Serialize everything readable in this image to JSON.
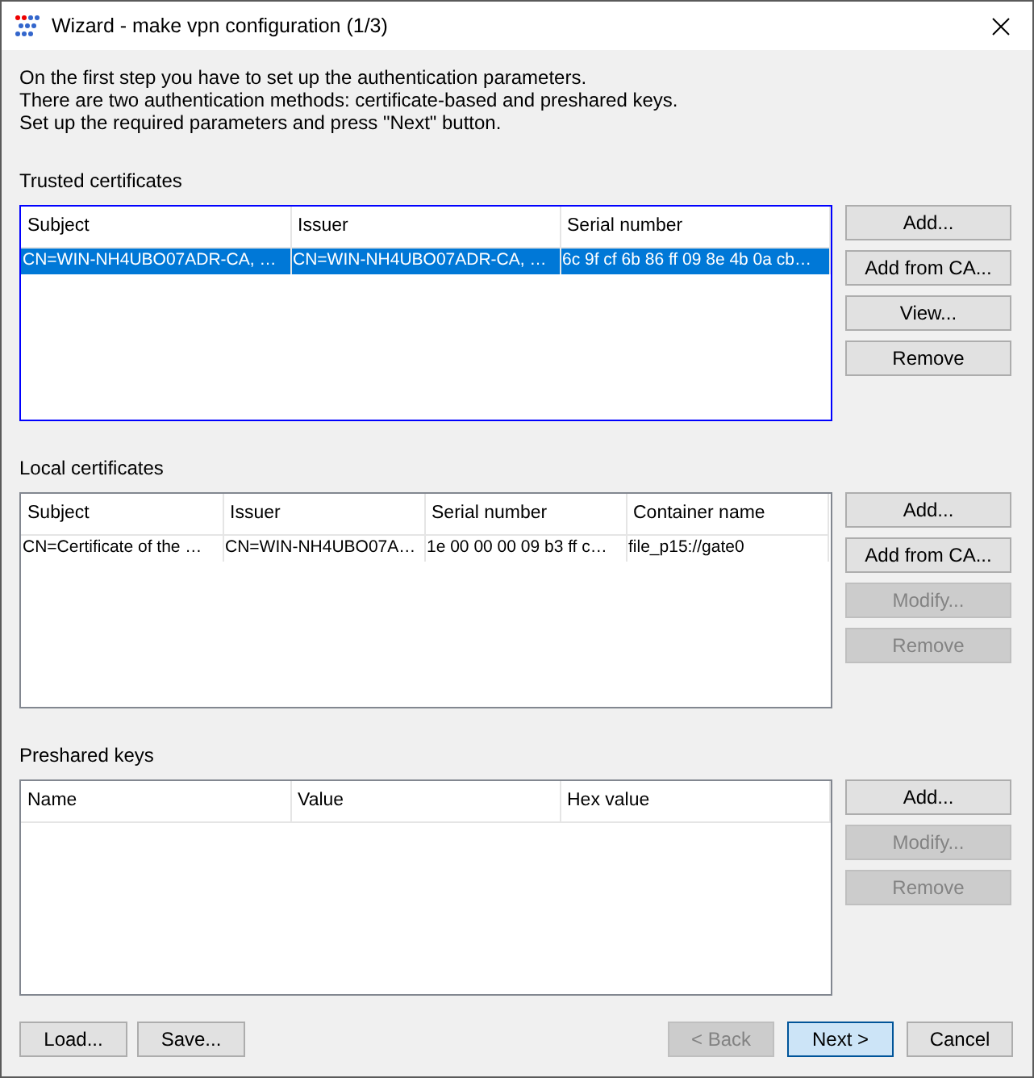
{
  "window": {
    "title": "Wizard - make vpn configuration (1/3)"
  },
  "intro": [
    "On the first step you have to set up the authentication parameters.",
    "There are two authentication methods: certificate-based and preshared keys.",
    "Set up the required parameters and press \"Next\" button."
  ],
  "sections": [
    {
      "title": "Trusted certificates",
      "focused": true,
      "columns": [
        "Subject",
        "Issuer",
        "Serial number"
      ],
      "rows": [
        {
          "cells": [
            "CN=WIN-NH4UBO07ADR-CA, …",
            "CN=WIN-NH4UBO07ADR-CA, …",
            "6c 9f cf 6b 86 ff 09 8e 4b 0a cb…"
          ],
          "selected": true
        }
      ],
      "buttons": [
        {
          "label": "Add...",
          "disabled": false
        },
        {
          "label": "Add from CA...",
          "disabled": false
        },
        {
          "label": "View...",
          "disabled": false
        },
        {
          "label": "Remove",
          "disabled": false
        }
      ]
    },
    {
      "title": "Local certificates",
      "focused": false,
      "columns": [
        "Subject",
        "Issuer",
        "Serial number",
        "Container name"
      ],
      "rows": [
        {
          "cells": [
            "CN=Certificate of the …",
            "CN=WIN-NH4UBO07A…",
            "1e 00 00 00 09 b3 ff c…",
            "file_p15://gate0"
          ],
          "selected": false
        }
      ],
      "buttons": [
        {
          "label": "Add...",
          "disabled": false
        },
        {
          "label": "Add from CA...",
          "disabled": false
        },
        {
          "label": "Modify...",
          "disabled": true
        },
        {
          "label": "Remove",
          "disabled": true
        }
      ]
    },
    {
      "title": "Preshared keys",
      "focused": false,
      "columns": [
        "Name",
        "Value",
        "Hex value"
      ],
      "buttons": [
        {
          "label": "Add...",
          "disabled": false
        },
        {
          "label": "Modify...",
          "disabled": true
        },
        {
          "label": "Remove",
          "disabled": true
        }
      ]
    }
  ],
  "footer_left": [
    {
      "label": "Load...",
      "disabled": false,
      "default": false
    },
    {
      "label": "Save...",
      "disabled": false,
      "default": false
    }
  ],
  "footer_right": [
    {
      "label": "< Back",
      "disabled": true,
      "default": false
    },
    {
      "label": "Next >",
      "disabled": false,
      "default": true
    },
    {
      "label": "Cancel",
      "disabled": false,
      "default": false
    }
  ]
}
